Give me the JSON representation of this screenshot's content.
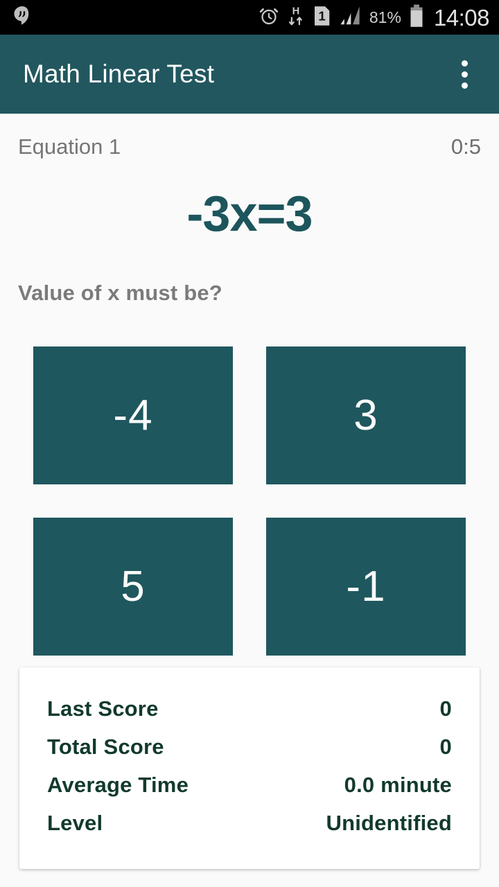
{
  "statusbar": {
    "notification_icon": "hangouts-icon",
    "icons": [
      "alarm-icon",
      "hspa-data-icon",
      "sim1-icon",
      "signal-icon"
    ],
    "hspa_label": "H",
    "sim_label": "1",
    "battery_percent": "81%",
    "clock": "14:08"
  },
  "appbar": {
    "title": "Math Linear Test",
    "overflow_icon": "more-vert-icon"
  },
  "quiz": {
    "question_label": "Equation 1",
    "timer": "0:5",
    "equation": "-3x=3",
    "prompt": "Value of x must be?",
    "answers": [
      {
        "label": "-4"
      },
      {
        "label": "3"
      },
      {
        "label": "5"
      },
      {
        "label": "-1"
      }
    ]
  },
  "stats": {
    "rows": [
      {
        "key": "Last Score",
        "value": "0"
      },
      {
        "key": "Total Score",
        "value": "0"
      },
      {
        "key": "Average Time",
        "value": "0.0 minute"
      },
      {
        "key": "Level",
        "value": "Unidentified"
      }
    ]
  },
  "colors": {
    "primary": "#22575f",
    "button": "#1f575e",
    "equation": "#1d555c",
    "stat_text": "#123a2c",
    "background": "#fafafa"
  }
}
